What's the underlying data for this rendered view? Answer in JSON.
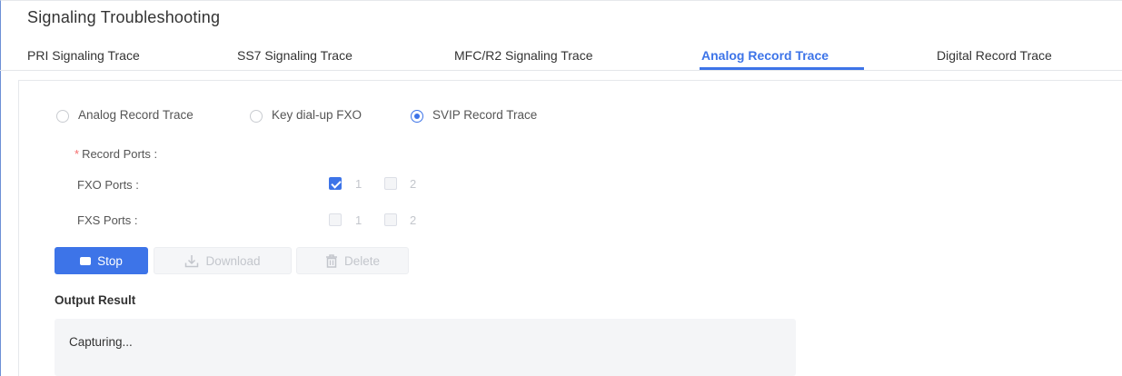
{
  "page": {
    "title": "Signaling Troubleshooting"
  },
  "tabs": [
    {
      "label": "PRI Signaling Trace",
      "active": false
    },
    {
      "label": "SS7 Signaling Trace",
      "active": false
    },
    {
      "label": "MFC/R2 Signaling Trace",
      "active": false
    },
    {
      "label": "Analog Record Trace",
      "active": true
    },
    {
      "label": "Digital Record Trace",
      "active": false
    }
  ],
  "trace_type": {
    "options": [
      {
        "label": "Analog Record Trace",
        "checked": false
      },
      {
        "label": "Key dial-up FXO",
        "checked": false
      },
      {
        "label": "SVIP Record Trace",
        "checked": true
      }
    ]
  },
  "record_ports": {
    "required_mark": "*",
    "label": "Record Ports :",
    "fxo": {
      "label": "FXO Ports :",
      "ports": [
        {
          "label": "1",
          "checked": true
        },
        {
          "label": "2",
          "checked": false
        }
      ]
    },
    "fxs": {
      "label": "FXS Ports :",
      "ports": [
        {
          "label": "1",
          "checked": false
        },
        {
          "label": "2",
          "checked": false
        }
      ]
    }
  },
  "actions": {
    "stop_label": "Stop",
    "download_label": "Download",
    "delete_label": "Delete"
  },
  "output": {
    "title": "Output Result",
    "text": "Capturing..."
  },
  "colors": {
    "accent": "#3d74e8",
    "required": "#f56c6c",
    "disabled_text": "#c3c6cc",
    "output_bg": "#f4f5f7"
  },
  "icons": {
    "stop": "stop-square-icon",
    "download": "download-icon",
    "delete": "trash-icon"
  }
}
